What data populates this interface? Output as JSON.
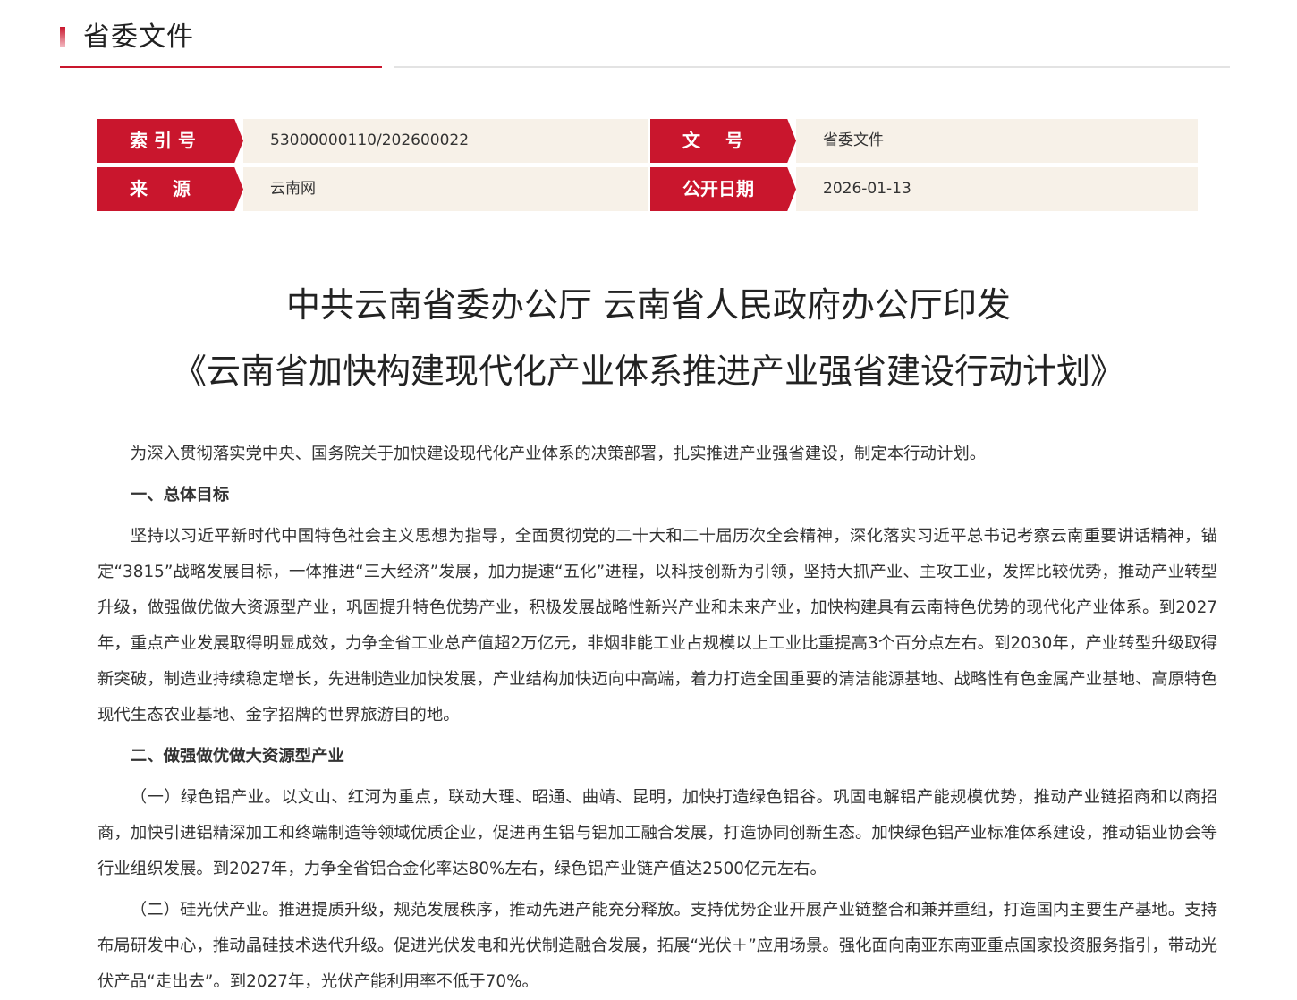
{
  "section": {
    "title": "省委文件"
  },
  "meta": {
    "index_label": "索 引 号",
    "index_value": "53000000110/202600022",
    "doc_no_label": "文    号",
    "doc_no_value": "省委文件",
    "source_label": "来    源",
    "source_value": "云南网",
    "date_label": "公开日期",
    "date_value": "2026-01-13"
  },
  "document": {
    "title_line1": "中共云南省委办公厅 云南省人民政府办公厅印发",
    "title_line2": "《云南省加快构建现代化产业体系推进产业强省建设行动计划》",
    "intro": "为深入贯彻落实党中央、国务院关于加快建设现代化产业体系的决策部署，扎实推进产业强省建设，制定本行动计划。",
    "heading1": "一、总体目标",
    "para1": "坚持以习近平新时代中国特色社会主义思想为指导，全面贯彻党的二十大和二十届历次全会精神，深化落实习近平总书记考察云南重要讲话精神，锚定“3815”战略发展目标，一体推进“三大经济”发展，加力提速“五化”进程，以科技创新为引领，坚持大抓产业、主攻工业，发挥比较优势，推动产业转型升级，做强做优做大资源型产业，巩固提升特色优势产业，积极发展战略性新兴产业和未来产业，加快构建具有云南特色优势的现代化产业体系。到2027年，重点产业发展取得明显成效，力争全省工业总产值超2万亿元，非烟非能工业占规模以上工业比重提高3个百分点左右。到2030年，产业转型升级取得新突破，制造业持续稳定增长，先进制造业加快发展，产业结构加快迈向中高端，着力打造全国重要的清洁能源基地、战略性有色金属产业基地、高原特色现代生态农业基地、金字招牌的世界旅游目的地。",
    "heading2": "二、做强做优做大资源型产业",
    "para2": "（一）绿色铝产业。以文山、红河为重点，联动大理、昭通、曲靖、昆明，加快打造绿色铝谷。巩固电解铝产能规模优势，推动产业链招商和以商招商，加快引进铝精深加工和终端制造等领域优质企业，促进再生铝与铝加工融合发展，打造协同创新生态。加快绿色铝产业标准体系建设，推动铝业协会等行业组织发展。到2027年，力争全省铝合金化率达80%左右，绿色铝产业链产值达2500亿元左右。",
    "para3": "（二）硅光伏产业。推进提质升级，规范发展秩序，推动先进产能充分释放。支持优势企业开展产业链整合和兼并重组，打造国内主要生产基地。支持布局研发中心，推动晶硅技术迭代升级。促进光伏发电和光伏制造融合发展，拓展“光伏＋”应用场景。强化面向南亚东南亚重点国家投资服务指引，带动光伏产品“走出去”。到2027年，光伏产能利用率不低于70%。"
  }
}
